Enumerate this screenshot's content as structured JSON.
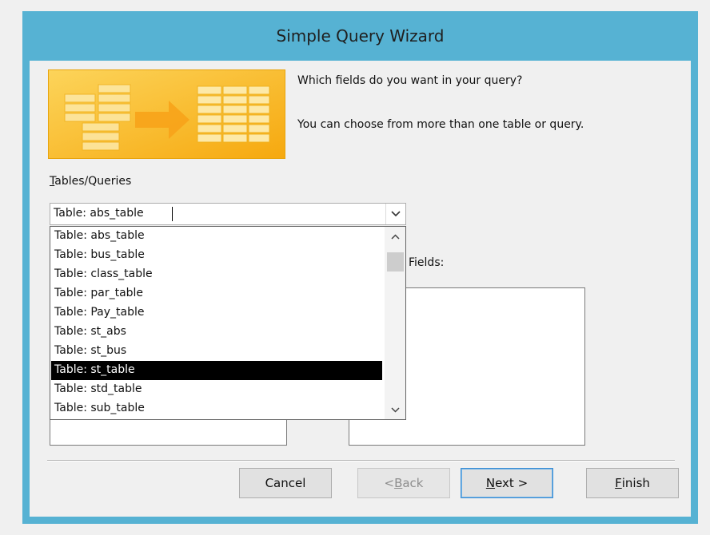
{
  "window": {
    "title": "Simple Query Wizard"
  },
  "prompt": {
    "line1": "Which fields do you want in your query?",
    "line2": "You can choose from more than one table or query."
  },
  "tables_queries": {
    "label_mnemonic": "T",
    "label_rest": "ables/Queries",
    "value": "Table: abs_table",
    "options": [
      "Table: abs_table",
      "Table: bus_table",
      "Table: class_table",
      "Table: par_table",
      "Table: Pay_table",
      "Table: st_abs",
      "Table: st_bus",
      "Table: st_table",
      "Table: std_table",
      "Table: sub_table"
    ],
    "highlighted": "Table: st_table"
  },
  "selected_fields": {
    "label_partial": "Fields:"
  },
  "buttons": {
    "cancel": "Cancel",
    "back_prefix": "< ",
    "back_mnemonic": "B",
    "back_rest": "ack",
    "next_mnemonic": "N",
    "next_rest": "ext >",
    "finish_mnemonic": "F",
    "finish_rest": "inish"
  },
  "colors": {
    "window_border": "#56b2d3",
    "banner": "#fbbf23",
    "selection": "#000000",
    "default_button_border": "#3c8ed4"
  }
}
